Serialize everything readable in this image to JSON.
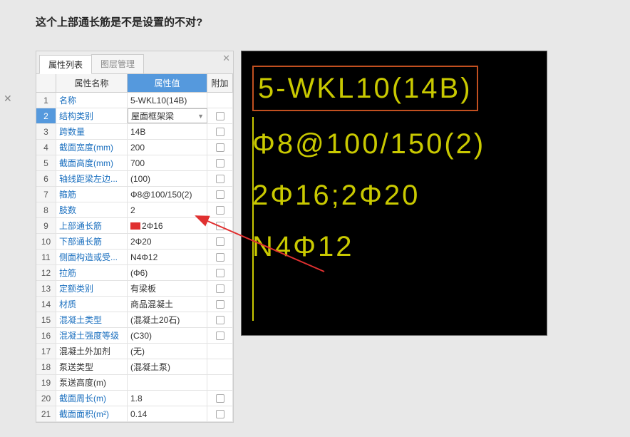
{
  "question": "这个上部通长筋是不是设置的不对?",
  "tabs": {
    "properties": "属性列表",
    "layers": "图层管理"
  },
  "headers": {
    "name": "属性名称",
    "value": "属性值",
    "extra": "附加"
  },
  "rows": [
    {
      "num": "1",
      "name": "名称",
      "value": "5-WKL10(14B)",
      "link": true,
      "checkbox": false
    },
    {
      "num": "2",
      "name": "结构类别",
      "value": "屋面框架梁",
      "link": true,
      "checkbox": true,
      "selected": true,
      "dropdown": true
    },
    {
      "num": "3",
      "name": "跨数量",
      "value": "14B",
      "link": true,
      "checkbox": true
    },
    {
      "num": "4",
      "name": "截面宽度(mm)",
      "value": "200",
      "link": true,
      "checkbox": true
    },
    {
      "num": "5",
      "name": "截面高度(mm)",
      "value": "700",
      "link": true,
      "checkbox": true
    },
    {
      "num": "6",
      "name": "轴线距梁左边...",
      "value": "(100)",
      "link": true,
      "checkbox": true
    },
    {
      "num": "7",
      "name": "箍筋",
      "value": "Φ8@100/150(2)",
      "link": true,
      "checkbox": true
    },
    {
      "num": "8",
      "name": "肢数",
      "value": "2",
      "link": true,
      "checkbox": true
    },
    {
      "num": "9",
      "name": "上部通长筋",
      "value": "2Φ16",
      "link": true,
      "checkbox": true,
      "highlight": true
    },
    {
      "num": "10",
      "name": "下部通长筋",
      "value": "2Φ20",
      "link": true,
      "checkbox": true
    },
    {
      "num": "11",
      "name": "侧面构造或受...",
      "value": "N4Φ12",
      "link": true,
      "checkbox": true
    },
    {
      "num": "12",
      "name": "拉筋",
      "value": "(Φ6)",
      "link": true,
      "checkbox": true
    },
    {
      "num": "13",
      "name": "定额类别",
      "value": "有梁板",
      "link": true,
      "checkbox": true
    },
    {
      "num": "14",
      "name": "材质",
      "value": "商品混凝土",
      "link": true,
      "checkbox": true
    },
    {
      "num": "15",
      "name": "混凝土类型",
      "value": "(混凝土20石)",
      "link": true,
      "checkbox": true
    },
    {
      "num": "16",
      "name": "混凝土强度等级",
      "value": "(C30)",
      "link": true,
      "checkbox": true
    },
    {
      "num": "17",
      "name": "混凝土外加剂",
      "value": "(无)",
      "link": false,
      "checkbox": false
    },
    {
      "num": "18",
      "name": "泵送类型",
      "value": "(混凝土泵)",
      "link": false,
      "checkbox": false
    },
    {
      "num": "19",
      "name": "泵送高度(m)",
      "value": "",
      "link": false,
      "checkbox": false
    },
    {
      "num": "20",
      "name": "截面周长(m)",
      "value": "1.8",
      "link": true,
      "checkbox": true
    },
    {
      "num": "21",
      "name": "截面面积(m²)",
      "value": "0.14",
      "link": true,
      "checkbox": true
    }
  ],
  "cad": {
    "line1": "5-WKL10(14B)",
    "line2": "Φ8@100/150(2)",
    "line3": "2Φ16;2Φ20",
    "line4": "N4Φ12"
  }
}
